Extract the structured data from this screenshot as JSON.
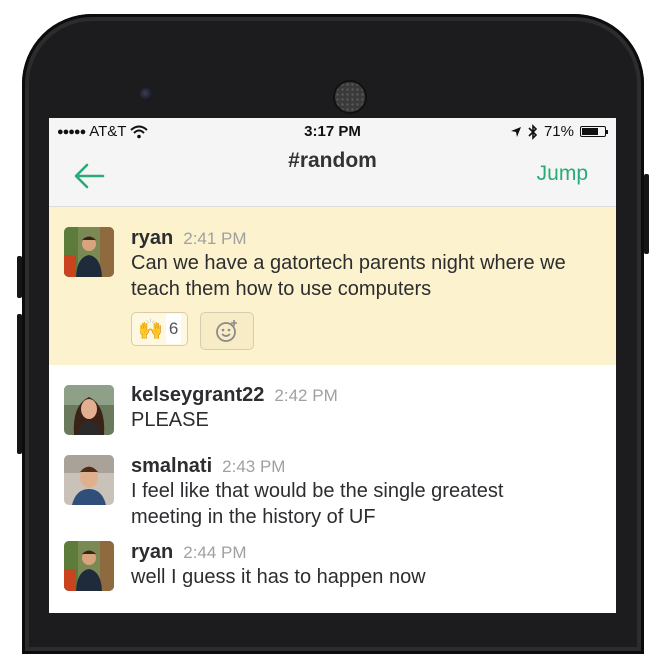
{
  "statusbar": {
    "carrier": "AT&T",
    "time": "3:17 PM",
    "battery": "71%",
    "battery_level": 0.71,
    "icons": [
      "signal-dots-icon",
      "wifi-icon",
      "location-arrow-icon",
      "bluetooth-icon",
      "battery-icon"
    ]
  },
  "navbar": {
    "title": "#random",
    "jump_label": "Jump",
    "accent_color": "#2aaa77"
  },
  "messages": [
    {
      "author": "ryan",
      "time": "2:41 PM",
      "lines": [
        "Can we have a gatortech parents night where we",
        "teach them how to use computers"
      ],
      "highlighted": true,
      "reactions": [
        {
          "emoji": "🙌",
          "emoji_name": "raised-hands-icon",
          "count": "6"
        }
      ],
      "add_reaction_icon": "add-emoji-icon"
    },
    {
      "author": "kelseygrant22",
      "time": "2:42 PM",
      "lines": [
        "PLEASE"
      ],
      "highlighted": false
    },
    {
      "author": "smalnati",
      "time": "2:43 PM",
      "lines": [
        "I feel like that would be the single greatest",
        "meeting in the history of UF"
      ],
      "highlighted": false
    },
    {
      "author": "ryan",
      "time": "2:44 PM",
      "lines": [
        "well I guess it has to happen now"
      ],
      "highlighted": false
    }
  ],
  "colors": {
    "highlight": "#fcf2cd",
    "accent": "#2aaa77",
    "phone_body": "#1c1c1e"
  }
}
